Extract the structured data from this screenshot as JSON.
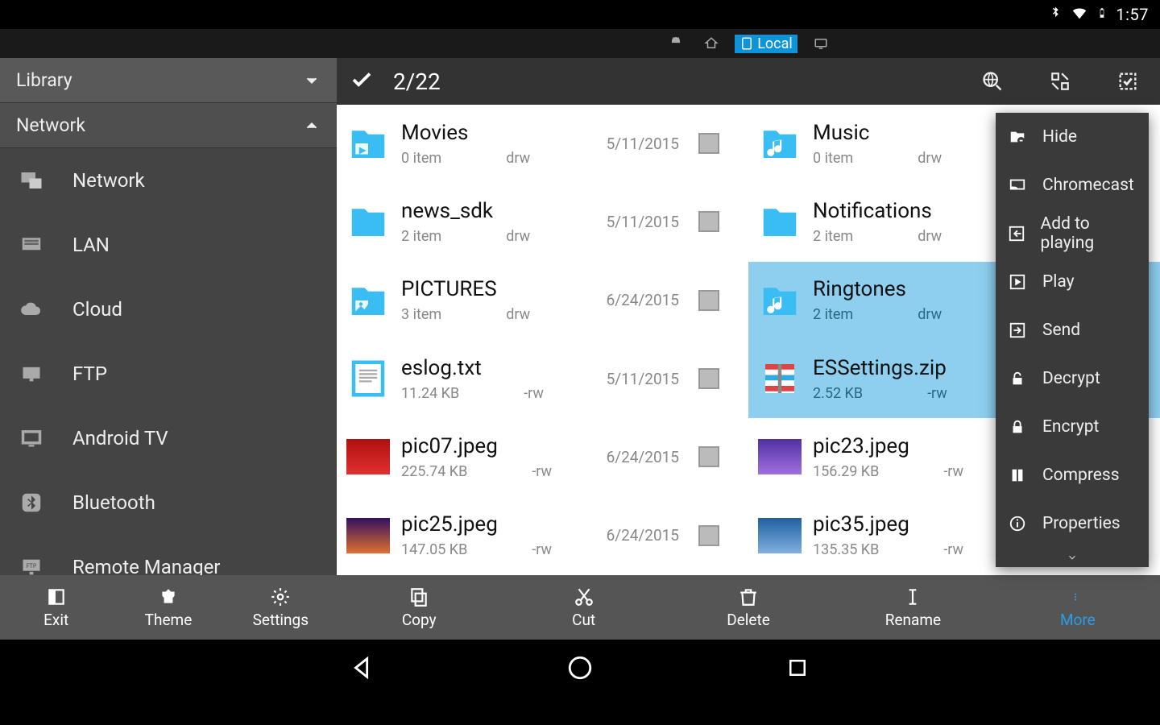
{
  "status": {
    "time": "1:57"
  },
  "top_tabs": {
    "local_label": "Local"
  },
  "sidebar": {
    "sections": {
      "library": "Library",
      "network": "Network"
    },
    "items": [
      "Network",
      "LAN",
      "Cloud",
      "FTP",
      "Android TV",
      "Bluetooth",
      "Remote Manager"
    ],
    "bottom": {
      "exit": "Exit",
      "theme": "Theme",
      "settings": "Settings"
    }
  },
  "selectbar": {
    "count": "2/22"
  },
  "files_left": [
    {
      "name": "Movies",
      "sub1": "0 item",
      "sub2": "drw",
      "date": "5/11/2015",
      "type": "folder-movies"
    },
    {
      "name": "news_sdk",
      "sub1": "2 item",
      "sub2": "drw",
      "date": "5/11/2015",
      "type": "folder"
    },
    {
      "name": "PICTURES",
      "sub1": "3 item",
      "sub2": "drw",
      "date": "6/24/2015",
      "type": "folder-pics"
    },
    {
      "name": "eslog.txt",
      "sub1": "11.24 KB",
      "sub2": "-rw",
      "date": "5/11/2015",
      "type": "txt"
    },
    {
      "name": "pic07.jpeg",
      "sub1": "225.74 KB",
      "sub2": "-rw",
      "date": "6/24/2015",
      "type": "image-red"
    },
    {
      "name": "pic25.jpeg",
      "sub1": "147.05 KB",
      "sub2": "-rw",
      "date": "6/24/2015",
      "type": "image-sunset"
    }
  ],
  "files_right": [
    {
      "name": "Music",
      "sub1": "0 item",
      "sub2": "drw",
      "date": "",
      "type": "folder-music"
    },
    {
      "name": "Notifications",
      "sub1": "2 item",
      "sub2": "drw",
      "date": "",
      "type": "folder"
    },
    {
      "name": "Ringtones",
      "sub1": "2 item",
      "sub2": "drw",
      "date": "",
      "type": "folder-music",
      "selected": true
    },
    {
      "name": "ESSettings.zip",
      "sub1": "2.52 KB",
      "sub2": "-rw",
      "date": "",
      "type": "zip",
      "selected": true
    },
    {
      "name": "pic23.jpeg",
      "sub1": "156.29 KB",
      "sub2": "-rw",
      "date": "",
      "type": "image-purple"
    },
    {
      "name": "pic35.jpeg",
      "sub1": "135.35 KB",
      "sub2": "-rw",
      "date": "",
      "type": "image-blue"
    }
  ],
  "content_bottom": {
    "copy": "Copy",
    "cut": "Cut",
    "delete": "Delete",
    "rename": "Rename",
    "more": "More"
  },
  "menu": [
    "Hide",
    "Chromecast",
    "Add to playing",
    "Play",
    "Send",
    "Decrypt",
    "Encrypt",
    "Compress",
    "Properties"
  ]
}
